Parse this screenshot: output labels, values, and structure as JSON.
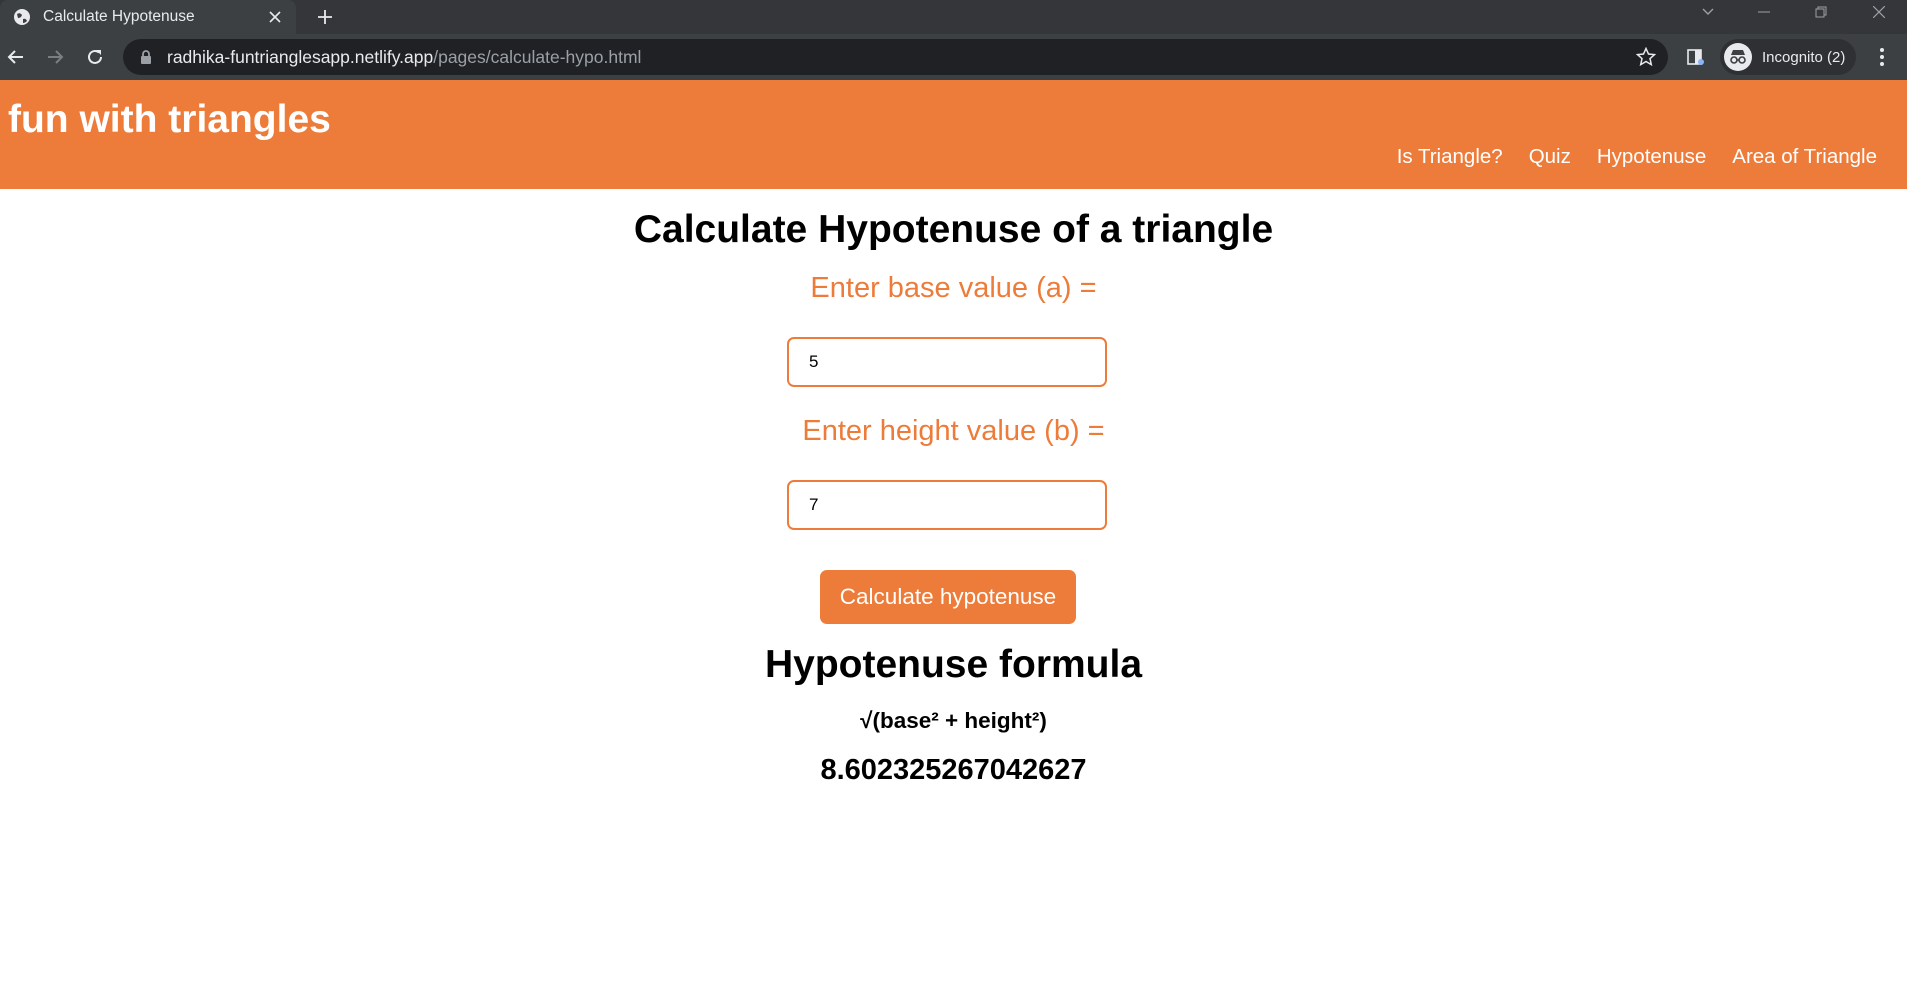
{
  "browser": {
    "tab_title": "Calculate Hypotenuse",
    "url_domain": "radhika-funtrianglesapp.netlify.app",
    "url_path": "/pages/calculate-hypo.html",
    "profile_label": "Incognito (2)"
  },
  "site": {
    "title": "fun with triangles",
    "nav": [
      "Is Triangle?",
      "Quiz",
      "Hypotenuse",
      "Area of Triangle"
    ]
  },
  "page": {
    "heading": "Calculate Hypotenuse of a triangle",
    "base_label": "Enter base value (a) =",
    "base_value": "5",
    "height_label": "Enter height value (b) =",
    "height_value": "7",
    "button_label": "Calculate hypotenuse",
    "formula_heading": "Hypotenuse formula",
    "formula": "√(base² + height²)",
    "result": "8.602325267042627"
  },
  "colors": {
    "accent": "#ed7c3a",
    "chrome_dark": "#35363a",
    "chrome_toolbar": "#3c4043",
    "omnibox": "#202124"
  }
}
